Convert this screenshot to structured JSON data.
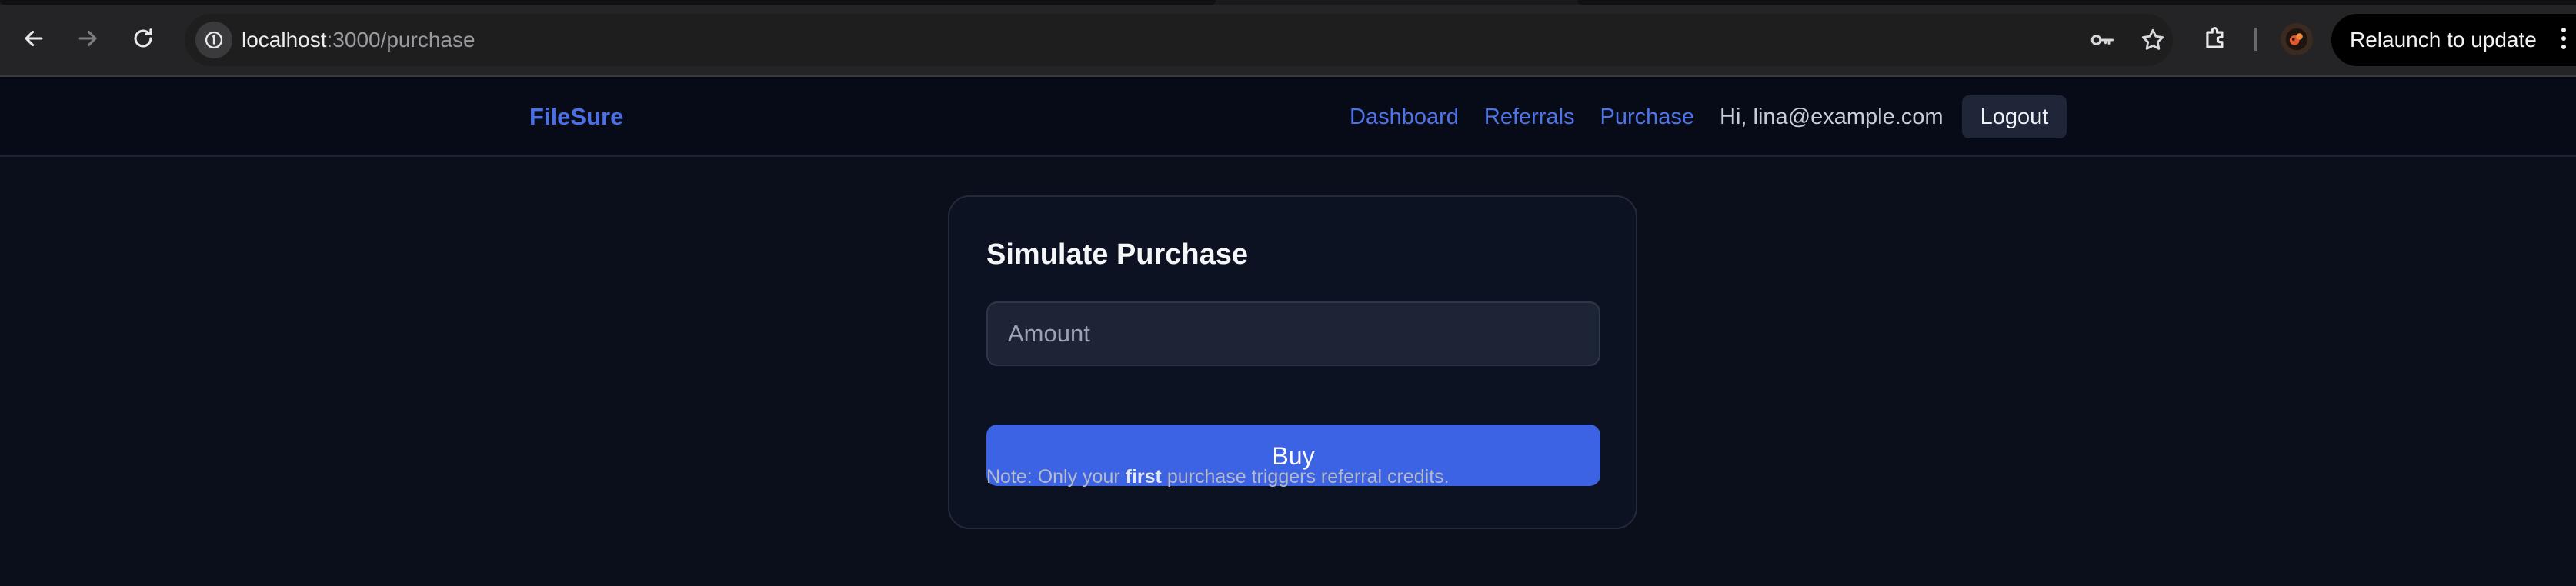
{
  "browser": {
    "url_host": "localhost",
    "url_path": ":3000/purchase",
    "relaunch_label": "Relaunch to update",
    "icons": {
      "back": "arrow-left-icon",
      "forward": "arrow-right-icon",
      "reload": "reload-icon",
      "site_info": "info-icon",
      "password": "key-icon",
      "bookmark": "star-icon",
      "extensions": "puzzle-icon",
      "menu": "kebab-menu-icon"
    }
  },
  "navbar": {
    "brand": "FileSure",
    "links": [
      {
        "label": "Dashboard"
      },
      {
        "label": "Referrals"
      },
      {
        "label": "Purchase"
      }
    ],
    "greeting": "Hi, lina@example.com",
    "logout_label": "Logout"
  },
  "purchase": {
    "title": "Simulate Purchase",
    "amount_placeholder": "Amount",
    "amount_value": "",
    "buy_label": "Buy",
    "note_prefix": "Note: Only your ",
    "note_emphasis": "first",
    "note_suffix": " purchase triggers referral credits."
  },
  "colors": {
    "accent": "#3b63e4",
    "link": "#4f74ea",
    "page_background": "#0b0f1c",
    "card_background": "#0d1222"
  }
}
